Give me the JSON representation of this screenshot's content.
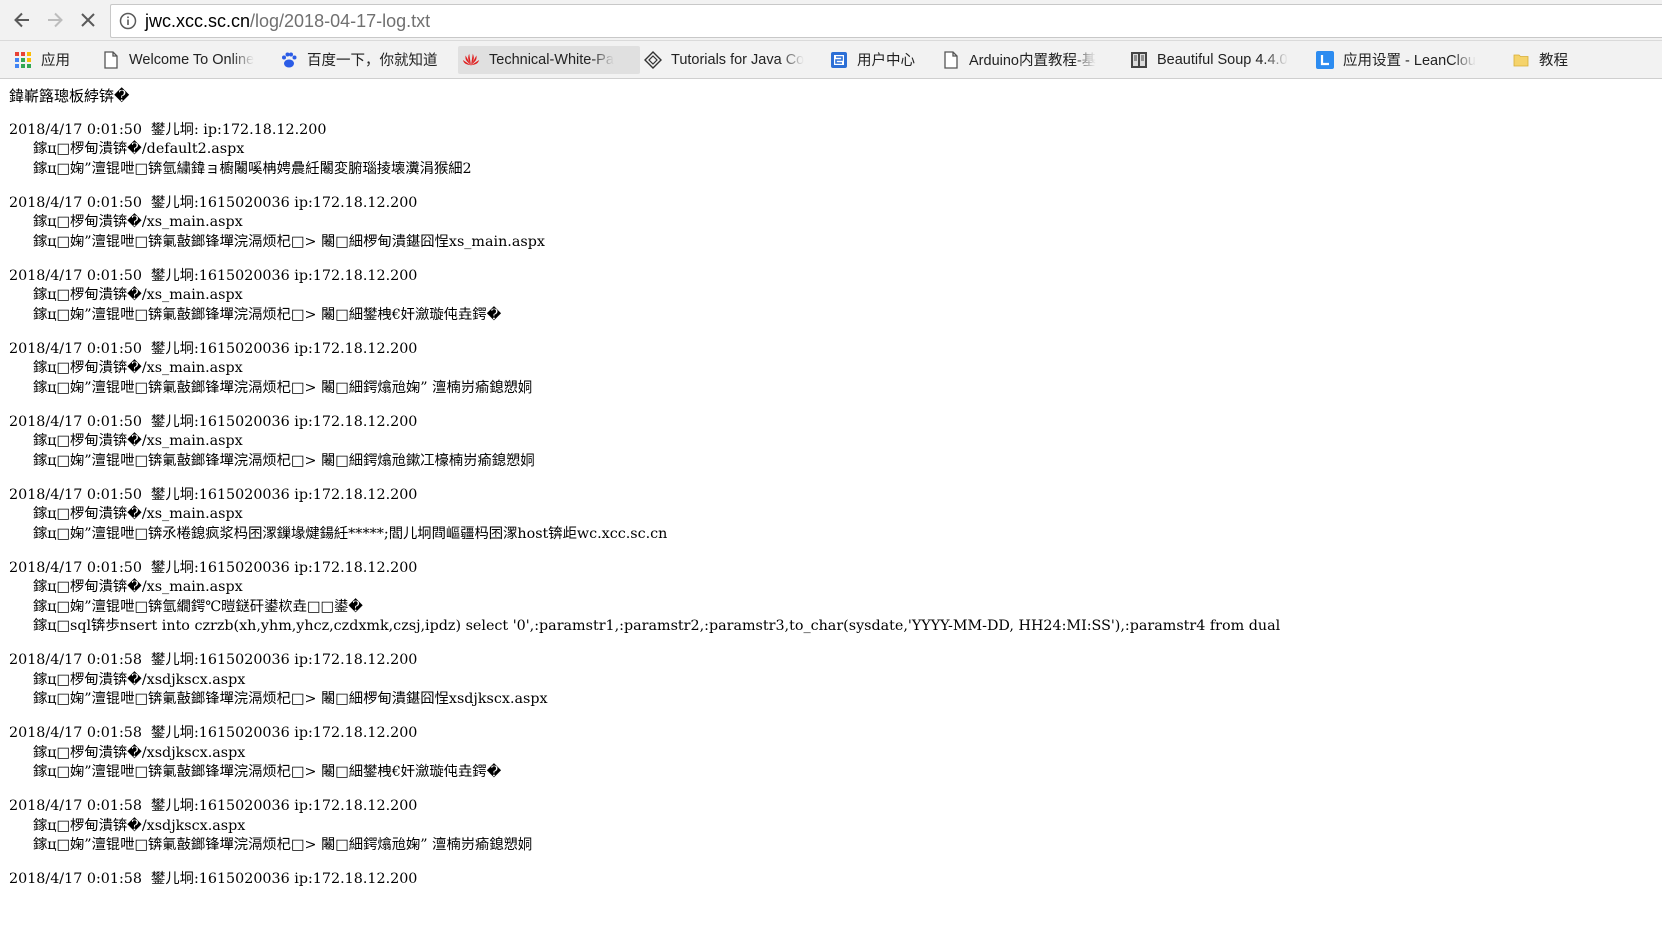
{
  "toolbar": {
    "url_host": "jwc.xcc.sc.cn",
    "url_path": "/log/2018-04-17-log.txt"
  },
  "bookmarks": [
    {
      "label": "应用",
      "icon": "apps-grid-icon"
    },
    {
      "label": "Welcome To Online",
      "icon": "page-icon"
    },
    {
      "label": "百度一下，你就知道",
      "icon": "baidu-paw-icon"
    },
    {
      "label": "Technical-White-Pa",
      "icon": "huawei-icon"
    },
    {
      "label": "Tutorials for Java Co",
      "icon": "diamond-icon"
    },
    {
      "label": "用户中心",
      "icon": "blue-square-icon"
    },
    {
      "label": "Arduino内置教程-基",
      "icon": "page-icon"
    },
    {
      "label": "Beautiful Soup 4.4.0",
      "icon": "book-icon"
    },
    {
      "label": "应用设置 - LeanClou",
      "icon": "leancloud-icon"
    },
    {
      "label": "教程",
      "icon": "folder-icon"
    }
  ],
  "log": {
    "header": "鍏嶄簬璁板綍锛�",
    "entries": [
      {
        "head": "2018/4/17 0:01:50  鐢儿坰: ip:172.18.12.200",
        "lines": [
          "鎵ц□椤甸潰锛�/default2.aspx",
          "鎵ц□婅”澶锟呭□锛氫繍鍏ョ櫥闂嗘柟娉曟紝闂変腑瑙掕壊瀵涓猴細2"
        ]
      },
      {
        "head": "2018/4/17 0:01:50  鐢儿坰:1615020036 ip:172.18.12.200",
        "lines": [
          "鎵ц□椤甸潰锛�/xs_main.aspx",
          "鎵ц□婅”澶锟呭□锛氭敼鎯锋墠浣滆烦杞□> 闂□細椤甸潰鍖囧悜xs_main.aspx"
        ]
      },
      {
        "head": "2018/4/17 0:01:50  鐢儿坰:1615020036 ip:172.18.12.200",
        "lines": [
          "鎵ц□椤甸潰锛�/xs_main.aspx",
          "鎵ц□婅”澶锟呭□锛氭敼鎯锋墠浣滆烦杞□> 闂□細鐢栧€奸瀲璇伅垚鍔�"
        ]
      },
      {
        "head": "2018/4/17 0:01:50  鐢儿坰:1615020036 ip:172.18.12.200",
        "lines": [
          "鎵ц□椤甸潰锛�/xs_main.aspx",
          "鎵ц□婅”澶锟呭□锛氭敼鎯锋墠浣滆烦杞□> 闂□細鍔熻兘婅” 澶楠岃瘉鎴愬姛"
        ]
      },
      {
        "head": "2018/4/17 0:01:50  鐢儿坰:1615020036 ip:172.18.12.200",
        "lines": [
          "鎵ц□椤甸潰锛�/xs_main.aspx",
          "鎵ц□婅”澶锟呭□锛氭敼鎯锋墠浣滆烦杞□> 闂□細鍔熻兘鏉冮檺楠岃瘉鎴愬姛"
        ]
      },
      {
        "head": "2018/4/17 0:01:50  鐢儿坰:1615020036 ip:172.18.12.200",
        "lines": [
          "鎵ц□椤甸潰锛�/xs_main.aspx",
          "鎵ц□婅”澶锟呭□锛氶棬鎴疯浆杩囨潈鏁堟煡鍚紝*****;閻儿坰閰嶇疆杩囨潈host锛歫wc.xcc.sc.cn"
        ]
      },
      {
        "head": "2018/4/17 0:01:50  鐢儿坰:1615020036 ip:172.18.12.200",
        "lines": [
          "鎵ц□椤甸潰锛�/xs_main.aspx",
          "鎵ц□婅”澶锟呭□锛氫繝鍔℃暟鎹矸鍙栨垚□□鍙�",
          "鎵ц□sql锛歩nsert into czrzb(xh,yhm,yhcz,czdxmk,czsj,ipdz) select '0',:paramstr1,:paramstr2,:paramstr3,to_char(sysdate,'YYYY-MM-DD, HH24:MI:SS'),:paramstr4 from dual"
        ]
      },
      {
        "head": "2018/4/17 0:01:58  鐢儿坰:1615020036 ip:172.18.12.200",
        "lines": [
          "鎵ц□椤甸潰锛�/xsdjkscx.aspx",
          "鎵ц□婅”澶锟呭□锛氭敼鎯锋墠浣滆烦杞□> 闂□細椤甸潰鍖囧悜xsdjkscx.aspx"
        ]
      },
      {
        "head": "2018/4/17 0:01:58  鐢儿坰:1615020036 ip:172.18.12.200",
        "lines": [
          "鎵ц□椤甸潰锛�/xsdjkscx.aspx",
          "鎵ц□婅”澶锟呭□锛氭敼鎯锋墠浣滆烦杞□> 闂□細鐢栧€奸瀲璇伅垚鍔�"
        ]
      },
      {
        "head": "2018/4/17 0:01:58  鐢儿坰:1615020036 ip:172.18.12.200",
        "lines": [
          "鎵ц□椤甸潰锛�/xsdjkscx.aspx",
          "鎵ц□婅”澶锟呭□锛氭敼鎯锋墠浣滆烦杞□> 闂□細鍔熻兘婅” 澶楠岃瘉鎴愬姛"
        ]
      },
      {
        "head": "2018/4/17 0:01:58  鐢儿坰:1615020036 ip:172.18.12.200",
        "lines": []
      }
    ]
  }
}
